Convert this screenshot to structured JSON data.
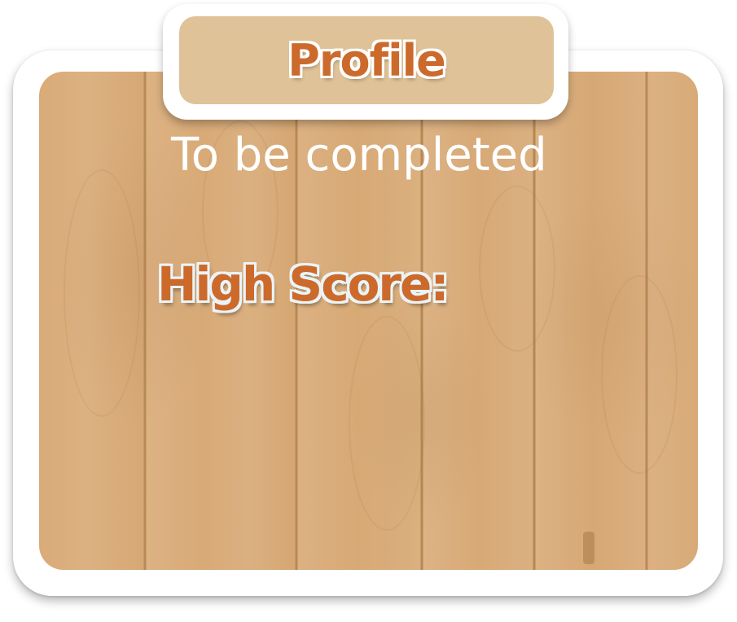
{
  "profile_panel": {
    "title": "Profile",
    "status_text": "To be completed",
    "high_score_label": "High Score:"
  },
  "colors": {
    "title_text": "#cc6a2c",
    "title_tab_bg": "#dfc297",
    "wood_base": "#d9ab78",
    "status_text": "#ffffff",
    "frame": "#ffffff"
  }
}
